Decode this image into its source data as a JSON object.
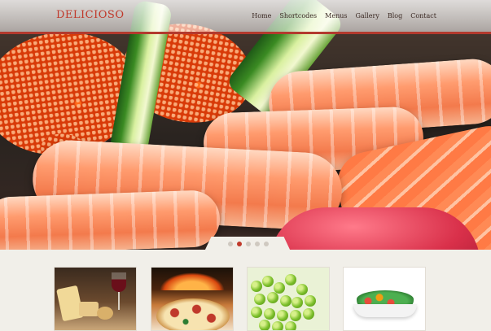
{
  "site": {
    "logo": "DELICIOSO"
  },
  "nav": {
    "items": [
      {
        "label": "Home"
      },
      {
        "label": "Shortcodes"
      },
      {
        "label": "Menus"
      },
      {
        "label": "Gallery"
      },
      {
        "label": "Blog"
      },
      {
        "label": "Contact"
      }
    ]
  },
  "slider": {
    "slide_count": 5,
    "active_slide": 2
  },
  "thumbnails": [
    {
      "icon": "cheese-wine-photo"
    },
    {
      "icon": "pizza-photo"
    },
    {
      "icon": "green-peas-photo"
    },
    {
      "icon": "salad-bowl-photo"
    }
  ],
  "colors": {
    "brand_red": "#c0392b",
    "nav_text": "#3b2a24",
    "page_bg": "#f1efe9",
    "dot_inactive": "#cfc9c0"
  }
}
